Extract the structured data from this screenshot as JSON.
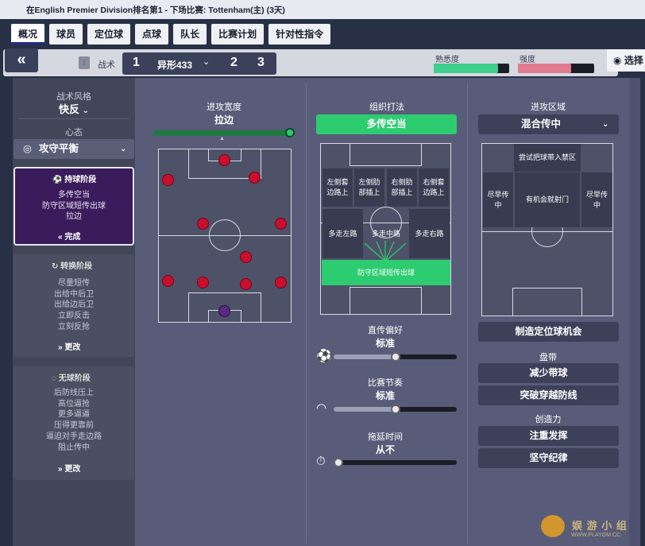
{
  "header": {
    "status": "在English Premier Division排名第1 - 下场比赛: Tottenham(主) (3天)"
  },
  "tabs": [
    "概况",
    "球员",
    "定位球",
    "点球",
    "队长",
    "比赛计划",
    "针对性指令"
  ],
  "toolbar": {
    "back_icon": "«",
    "tactic_label": "战术",
    "tactic_slot1": "1",
    "formation": "异形433",
    "tactic_slot2": "2",
    "tactic_slot3": "3",
    "familiarity_label": "熟悉度",
    "familiarity_value": 0.85,
    "intensity_label": "强度",
    "intensity_value": 0.7,
    "select_label": "选择"
  },
  "left": {
    "style_label": "战术风格",
    "style_value": "快反",
    "mentality_label": "心态",
    "mentality_value": "攻守平衡",
    "in_possession": {
      "title": "持球阶段",
      "items": [
        "多传空当",
        "防守区域短传出球",
        "拉边"
      ],
      "action": "完成"
    },
    "transition": {
      "title": "转换阶段",
      "items": [
        "尽量短传",
        "出给中后卫",
        "出给边后卫",
        "立即反击",
        "立刻反抢"
      ],
      "action": "更改"
    },
    "out_of_possession": {
      "title": "无球阶段",
      "items": [
        "后防线压上",
        "高位逼抢",
        "更多逼逼",
        "压得更靠前",
        "逼迫对手走边路",
        "阻止传中"
      ],
      "action": "更改"
    }
  },
  "attack_width": {
    "label": "进攻宽度",
    "value": "拉边"
  },
  "build_up": {
    "label": "组织打法",
    "value": "多传空当",
    "zones": [
      "左侧套\n边路上",
      "左侧肋\n部插上",
      "右侧肋\n部插上",
      "右侧套\n边路上",
      "多走左路",
      "多走中路",
      "多走右路",
      "防守区域短传出球"
    ]
  },
  "passing": {
    "label": "直传偏好",
    "value": "标准",
    "level": 0.5
  },
  "tempo": {
    "label": "比赛节奏",
    "value": "标准",
    "level": 0.5
  },
  "time_wasting": {
    "label": "拖延时间",
    "value": "从不",
    "level": 0.0
  },
  "final_third": {
    "label": "进攻区域",
    "value": "混合传中",
    "zones": [
      "尝试把球带入禁区",
      "尽早传\n中",
      "有机会就射门",
      "尽早传\n中"
    ]
  },
  "set_piece_btn": "制造定位球机会",
  "dribbling": {
    "label": "盘带",
    "value": "减少带球"
  },
  "break_line_btn": "突破穿越防线",
  "creativity": {
    "label": "创造力",
    "value1": "注重发挥",
    "value2": "坚守纪律"
  },
  "watermark": {
    "title": "娱 游 小 组",
    "url": "WWW.PLAYGM.CC"
  },
  "colors": {
    "accent_green": "#2ecc71",
    "familiarity": "#3ecf8e",
    "intensity": "#e07a8f",
    "in_possession_bg": "#3a1c5c",
    "player_red": "#c8102e",
    "gk_purple": "#5a2a82"
  }
}
